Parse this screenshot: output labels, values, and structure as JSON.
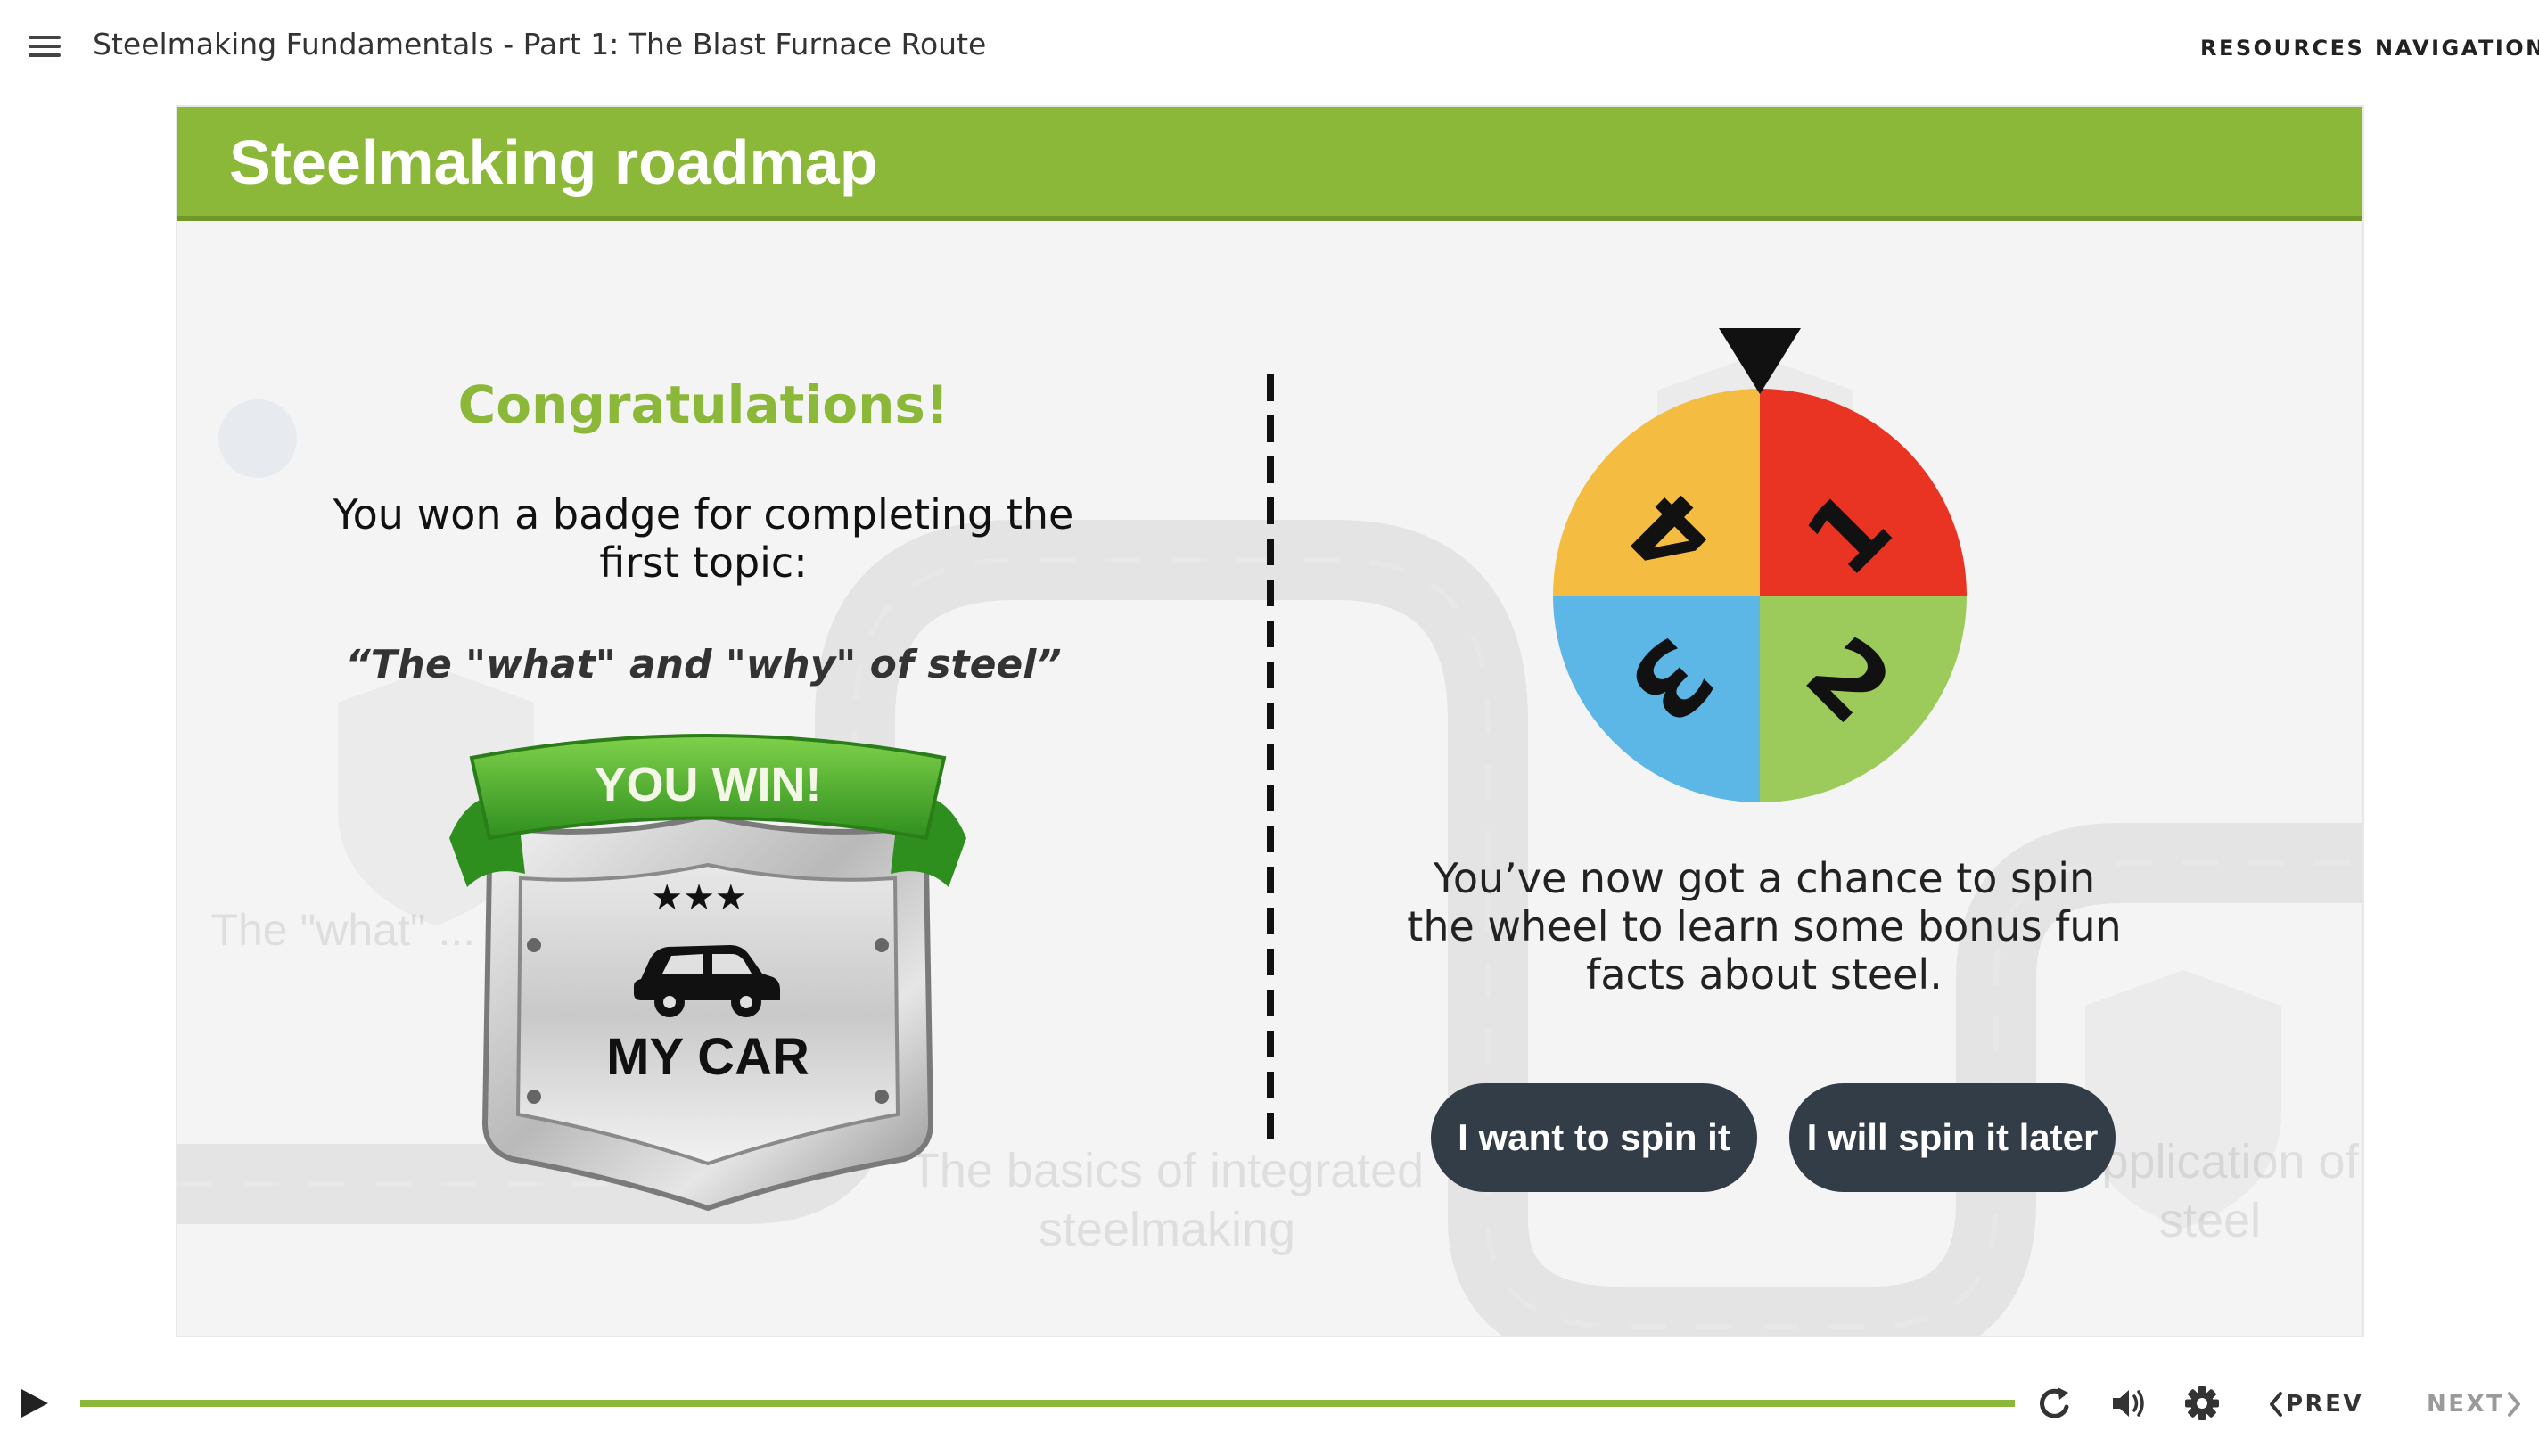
{
  "app": {
    "course_title": "Steelmaking Fundamentals - Part 1: The Blast Furnace Route",
    "resources_label": "RESOURCES",
    "navigation_label": "NAVIGATION"
  },
  "slide": {
    "title": "Steelmaking roadmap",
    "background_labels": {
      "topic_one": "The \"what\" ... of st",
      "topic_two": "The basics of integrated steelmaking",
      "topic_last": "...pplication of steel"
    },
    "left": {
      "congrats": "Congratulations!",
      "won_text": "You won a badge for completing the first topic:",
      "topic_name": "“The \"what\" and \"why\" of steel”",
      "badge": {
        "ribbon_text": "YOU WIN!",
        "label": "MY CAR",
        "stars": "★★★",
        "icon": "car-icon"
      }
    },
    "right": {
      "wheel": {
        "segments": [
          {
            "label": "1",
            "color": "#e93323"
          },
          {
            "label": "2",
            "color": "#9ccb5b"
          },
          {
            "label": "3",
            "color": "#5cb6e6"
          },
          {
            "label": "4",
            "color": "#f5bc42"
          }
        ],
        "pointer_color": "#111111"
      },
      "spin_text": "You’ve now got a chance to spin the wheel to learn some bonus fun facts about steel.",
      "spin_now_label": "I want to spin it",
      "spin_later_label": "I will spin it later"
    }
  },
  "player": {
    "progress": 1.0,
    "prev_label": "PREV",
    "next_label": "NEXT",
    "icons": [
      "play-icon",
      "replay-icon",
      "volume-icon",
      "settings-icon"
    ]
  },
  "colors": {
    "accent_green": "#8cb83a",
    "button_dark": "#333d47"
  }
}
